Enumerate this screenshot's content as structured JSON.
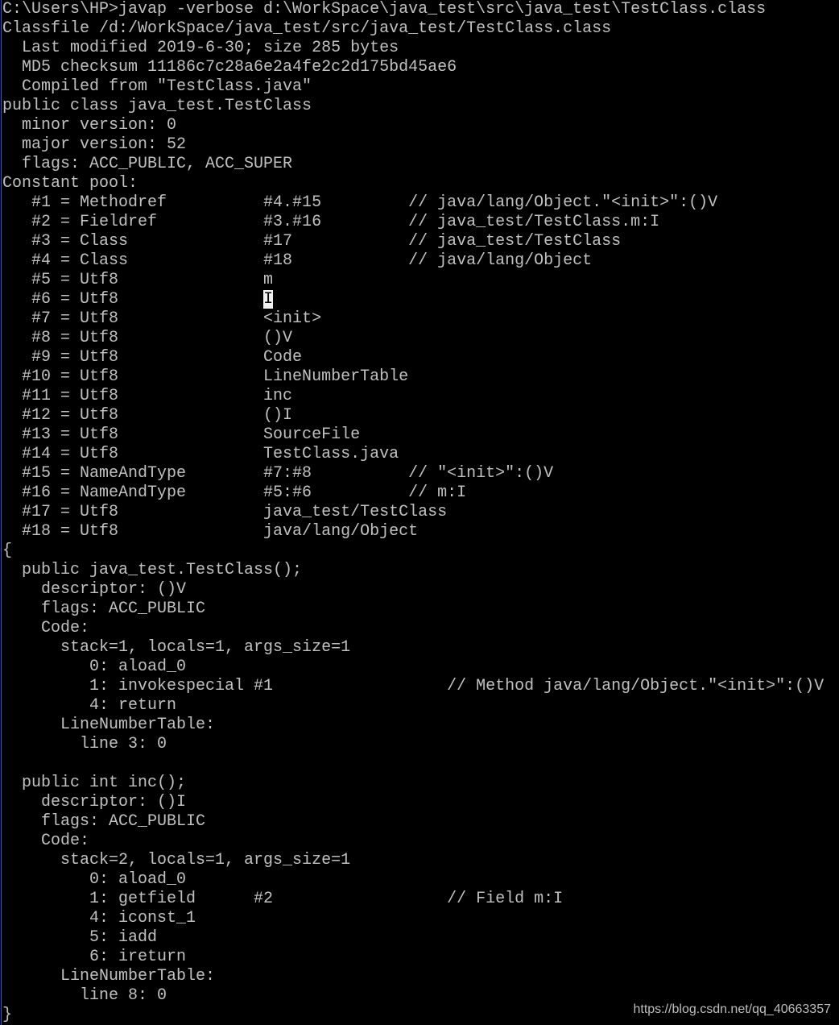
{
  "terminal": {
    "lines": [
      "C:\\Users\\HP>javap -verbose d:\\WorkSpace\\java_test\\src\\java_test\\TestClass.class",
      "Classfile /d:/WorkSpace/java_test/src/java_test/TestClass.class",
      "  Last modified 2019-6-30; size 285 bytes",
      "  MD5 checksum 11186c7c28a6e2a4fe2c2d175bd45ae6",
      "  Compiled from \"TestClass.java\"",
      "public class java_test.TestClass",
      "  minor version: 0",
      "  major version: 52",
      "  flags: ACC_PUBLIC, ACC_SUPER",
      "Constant pool:",
      "   #1 = Methodref          #4.#15         // java/lang/Object.\"<init>\":()V",
      "   #2 = Fieldref           #3.#16         // java_test/TestClass.m:I",
      "   #3 = Class              #17            // java_test/TestClass",
      "   #4 = Class              #18            // java/lang/Object",
      "   #5 = Utf8               m",
      "   #6 = Utf8               ",
      "   #7 = Utf8               <init>",
      "   #8 = Utf8               ()V",
      "   #9 = Utf8               Code",
      "  #10 = Utf8               LineNumberTable",
      "  #11 = Utf8               inc",
      "  #12 = Utf8               ()I",
      "  #13 = Utf8               SourceFile",
      "  #14 = Utf8               TestClass.java",
      "  #15 = NameAndType        #7:#8          // \"<init>\":()V",
      "  #16 = NameAndType        #5:#6          // m:I",
      "  #17 = Utf8               java_test/TestClass",
      "  #18 = Utf8               java/lang/Object",
      "{",
      "  public java_test.TestClass();",
      "    descriptor: ()V",
      "    flags: ACC_PUBLIC",
      "    Code:",
      "      stack=1, locals=1, args_size=1",
      "         0: aload_0",
      "         1: invokespecial #1                  // Method java/lang/Object.\"<init>\":()V",
      "         4: return",
      "      LineNumberTable:",
      "        line 3: 0",
      "",
      "  public int inc();",
      "    descriptor: ()I",
      "    flags: ACC_PUBLIC",
      "    Code:",
      "      stack=2, locals=1, args_size=1",
      "         0: aload_0",
      "         1: getfield      #2                  // Field m:I",
      "         4: iconst_1",
      "         5: iadd",
      "         6: ireturn",
      "      LineNumberTable:",
      "        line 8: 0",
      "}"
    ],
    "cursor_line_index": 15,
    "cursor_char": "I"
  },
  "watermark": "https://blog.csdn.net/qq_40663357"
}
